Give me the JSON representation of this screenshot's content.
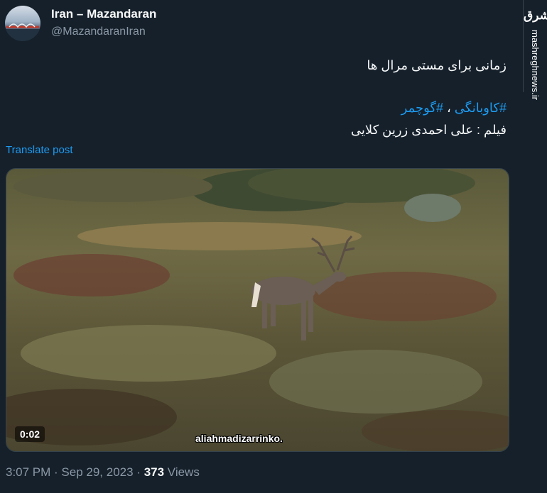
{
  "account": {
    "name": "Iran – Mazandaran",
    "handle": "@MazandaranIran"
  },
  "brand": {
    "logo_text": "مشرق",
    "site": "mashreghnews.ir"
  },
  "post": {
    "line1": "زمانی برای مستی مرال ها",
    "hashtag1": "#کاوبانگی",
    "separator": " ، ",
    "hashtag2": "#گوچمر",
    "line3": "فیلم : علی احمدی زرین کلایی",
    "translate_label": "Translate post"
  },
  "video": {
    "duration": "0:02",
    "watermark": "aliahmadizarrinko."
  },
  "meta": {
    "time": "3:07 PM",
    "dot1": " · ",
    "date": "Sep 29, 2023",
    "dot2": " · ",
    "views_count": "373",
    "views_label": " Views"
  },
  "colors": {
    "background": "#15202b",
    "link": "#1d9bf0",
    "secondary_text": "#8b98a5"
  }
}
